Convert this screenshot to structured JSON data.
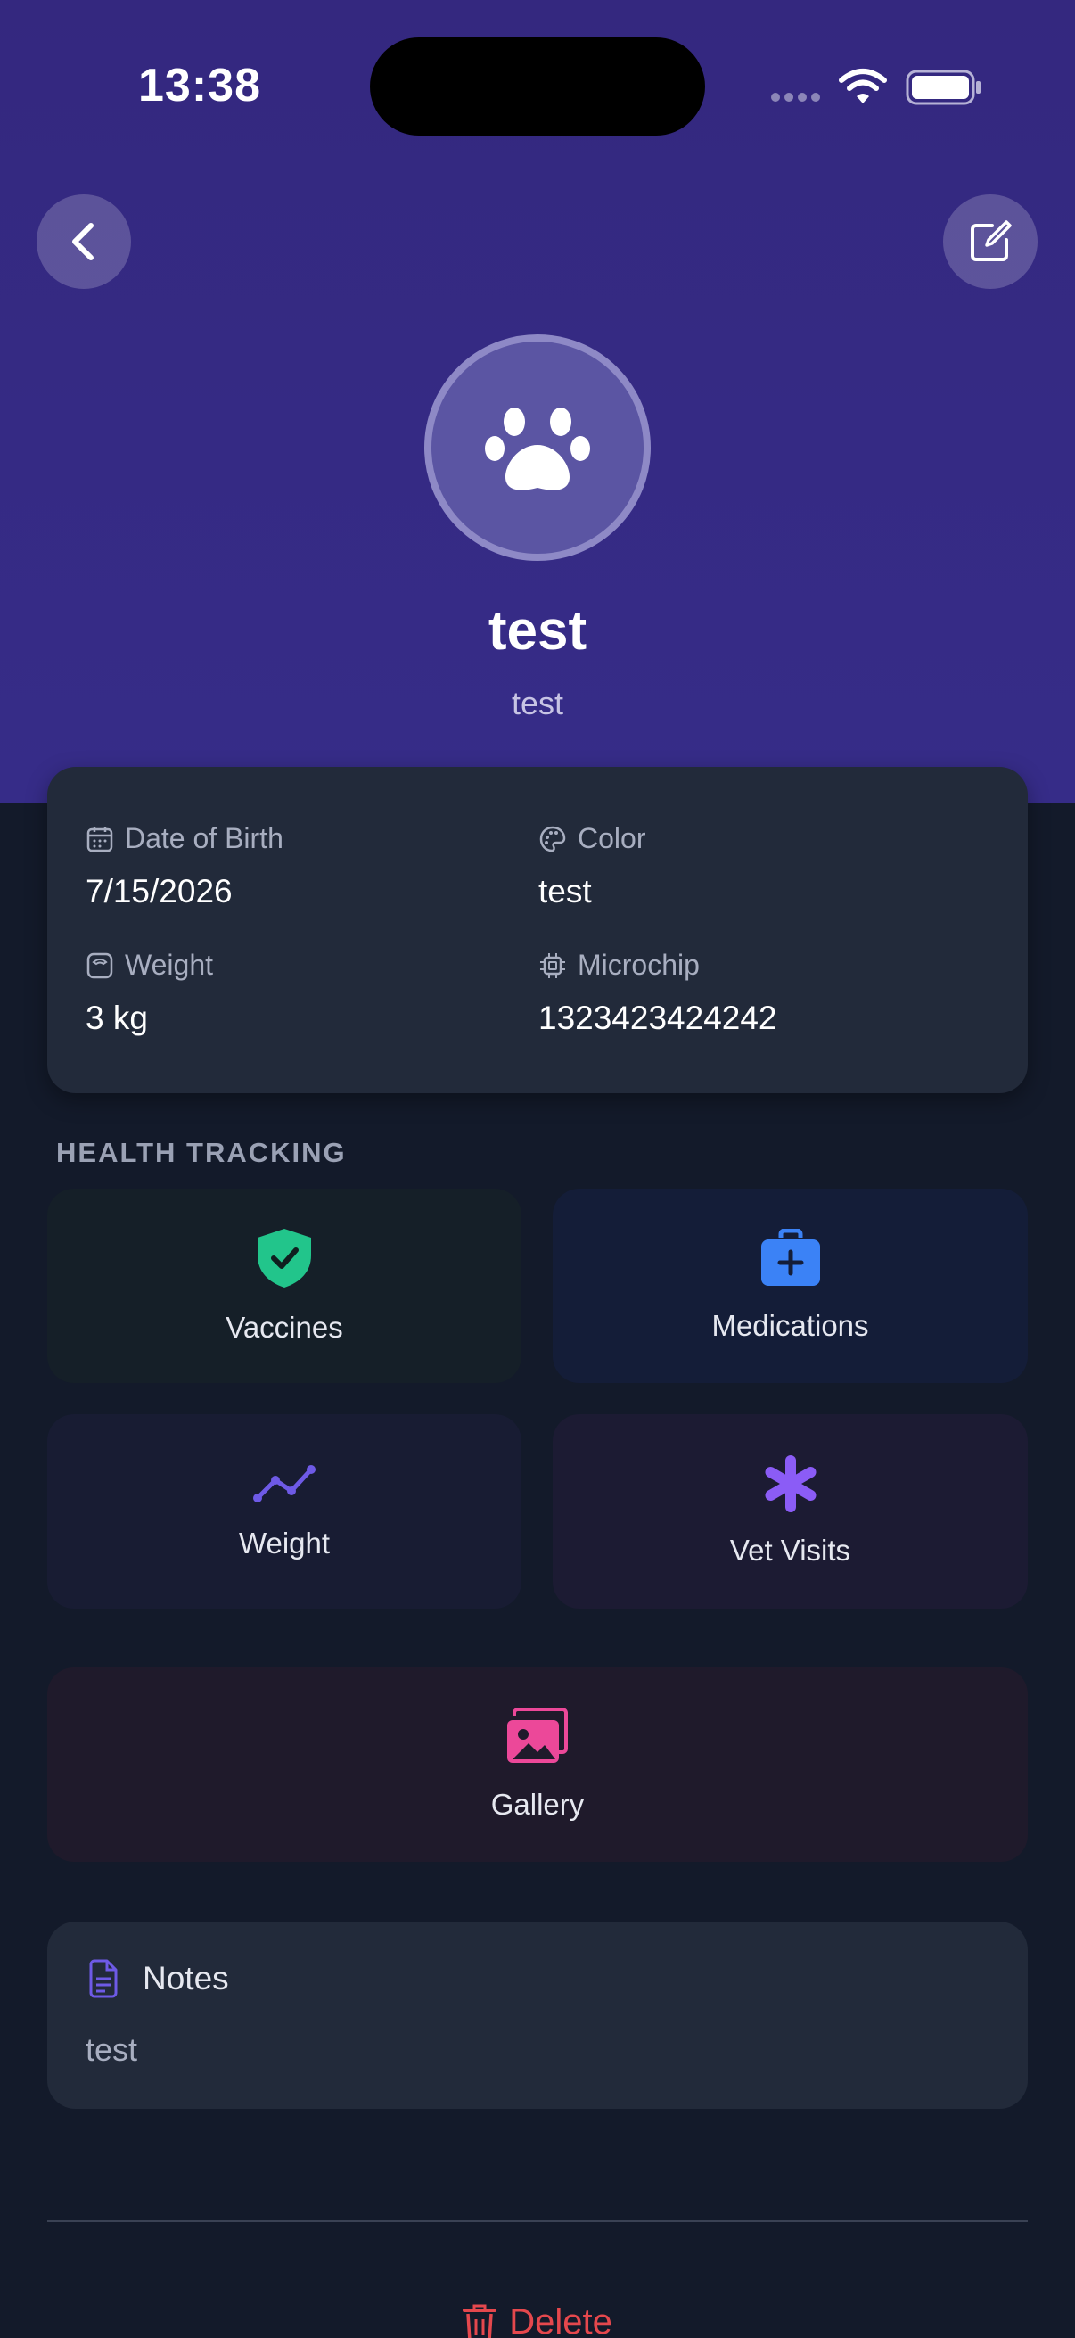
{
  "status_bar": {
    "time": "13:38"
  },
  "pet": {
    "name": "test",
    "subtitle": "test"
  },
  "details": {
    "dob": {
      "label": "Date of Birth",
      "value": "7/15/2026"
    },
    "color": {
      "label": "Color",
      "value": "test"
    },
    "weight": {
      "label": "Weight",
      "value": "3 kg"
    },
    "microchip": {
      "label": "Microchip",
      "value": "1323423424242"
    }
  },
  "health": {
    "section_title": "HEALTH TRACKING",
    "tiles": [
      {
        "label": "Vaccines",
        "icon": "shield-check-icon",
        "color": "#22c58b"
      },
      {
        "label": "Medications",
        "icon": "medkit-icon",
        "color": "#3b82f6"
      },
      {
        "label": "Weight",
        "icon": "trend-line-icon",
        "color": "#6e5ae6"
      },
      {
        "label": "Vet Visits",
        "icon": "asterisk-icon",
        "color": "#8b5cf6"
      }
    ]
  },
  "gallery": {
    "label": "Gallery",
    "icon": "images-icon",
    "color": "#ec4899"
  },
  "notes": {
    "title": "Notes",
    "text": "test"
  },
  "actions": {
    "delete_label": "Delete"
  },
  "colors": {
    "header": "#34287f",
    "background": "#131a2a",
    "card": "#222a3a",
    "danger": "#e5484d"
  }
}
